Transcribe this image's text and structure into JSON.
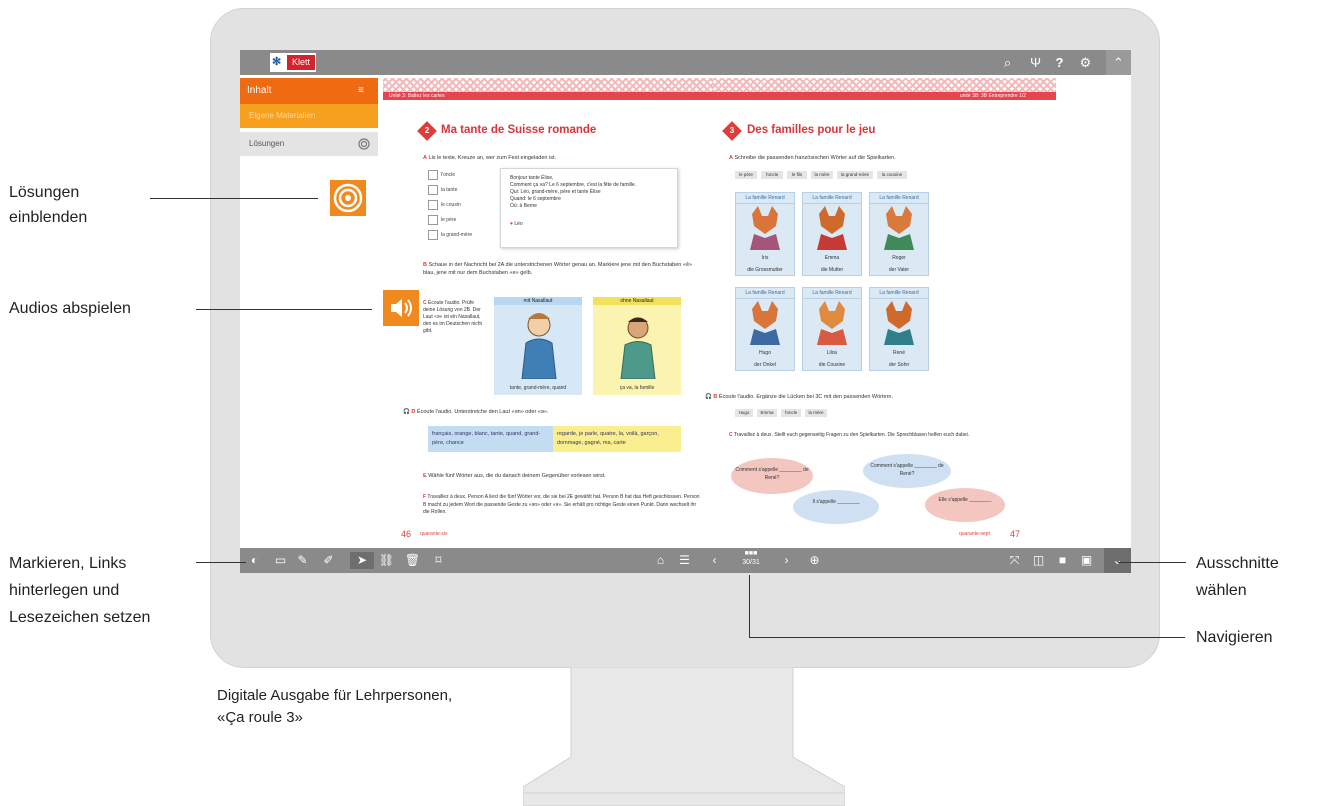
{
  "app": {
    "logo_text": "Klett",
    "topbar_icons": [
      "search-icon",
      "tuning-fork-icon",
      "help-icon",
      "settings-icon",
      "chevron-up-icon"
    ],
    "accent_orange": "#ee6b12",
    "accent_red": "#e03c3c"
  },
  "sidebar": {
    "inhalt": "Inhalt",
    "material": "Eigene Materialien",
    "loesungen": "Lösungen"
  },
  "left_page": {
    "header_left": "Unité 3: Battez les cartes",
    "section_number": "2",
    "section_title": "Ma tante de Suisse romande",
    "task_a": "Lis le texte. Kreuze an, wer zum Fest eingeladen ist.",
    "checkbox_items": [
      "l'oncle",
      "la tante",
      "le cousin",
      "le père",
      "la grand-mère"
    ],
    "postcard_lines": [
      "Bonjour tante Élise,",
      "Comment ça va? Le 6 septembre, c'est la fête de famille.",
      "Qui: Léo, grand-mère, père et tante Élise",
      "Quand: le 6 septembre",
      "Où: à Berne",
      "Léo"
    ],
    "task_b": "Schaue in der Nachricht bei 2A die unterstrichenen Wörter genau an. Markiere jene mit den Buchstaben «ê» blau, jene mit nur dem Buchstaben «e» gelb.",
    "task_c": "Écoute l'audio. Prüfe deine Lösung von 2B. Der Laut «ə» ist ein Nasallaut, den es im Deutschen nicht gibt.",
    "mit_nasallaut": "mit Nasallaut",
    "ohne_nasallaut": "ohne Nasallaut",
    "picture_left_caption": "tante, grand-mère, quand",
    "picture_right_caption": "ça va, la famille",
    "task_d": "Écoute l'audio. Unterstreiche den Laut «ən» oder «ə».",
    "words_blue": "français, orange, blanc, tante, quand, grand-père, chance",
    "words_yellow": "regarde, je parle, quatre, la, voilà, garçon, dommage, gagné, ma, carte",
    "task_e": "Wähle fünf Wörter aus, die du danach deinem Gegenüber vorlesen wirst.",
    "task_f": "Travaillez à deux. Person A liest die fünf Wörter vor, die sie bei 2E gewählt hat. Person B hat das Heft geschlossen. Person B macht zu jedem Wort die passende Geste zu «ən» oder «ə». Sie erhält pro richtige Geste einen Punkt. Dann wechselt ihr die Rollen.",
    "page_number": "46",
    "page_footer": "quarante-six"
  },
  "right_page": {
    "header_right": "unité 3B: 3B Entreprendre 1/2",
    "section_number": "3",
    "section_title": "Des familles pour le jeu",
    "task_a": "Schreibe die passenden französischen Wörter auf die Spielkarten.",
    "word_chips": [
      "le père",
      "l'oncle",
      "le fils",
      "la mère",
      "la grand-mère",
      "la cousine"
    ],
    "card_header": "La famille Renard",
    "cards": [
      {
        "name": "Iris",
        "role": "die Grossmutter"
      },
      {
        "name": "Emma",
        "role": "die Mutter"
      },
      {
        "name": "Roger",
        "role": "der Vater"
      },
      {
        "name": "Hugo",
        "role": "der Onkel"
      },
      {
        "name": "Lilou",
        "role": "die Cousine"
      },
      {
        "name": "René",
        "role": "der Sohn"
      }
    ],
    "task_b": "Écoute l'audio. Ergänze die Lücken bei 3C mit den passenden Wörtern.",
    "name_chips": [
      "Hugo",
      "Emma",
      "l'oncle",
      "la mère"
    ],
    "task_c": "Travaillez à deux. Stellt euch gegenseitig Fragen zu den Spielkarten. Die Sprechblasen helfen euch dabei.",
    "bubbles": [
      "Comment s'appelle ________ de René?",
      "Comment s'appelle ________ de René?",
      "Il s'appelle ________",
      "Elle s'appelle ________"
    ],
    "page_number": "47",
    "page_footer": "quarante-sept"
  },
  "bottombar": {
    "page_indicator": "30/31",
    "tools_left": [
      "toggle-icon",
      "note-icon",
      "pen-icon",
      "marker-icon",
      "pointer-icon",
      "link-icon",
      "trash-icon",
      "bookmark-icon"
    ],
    "nav_center": [
      "home-icon",
      "list-icon",
      "chevron-left-icon",
      "grid-icon",
      "chevron-right-icon",
      "zoom-icon"
    ],
    "view_right": [
      "fit-icon",
      "double-page-icon",
      "single-page-icon",
      "section-icon",
      "chevron-down-icon"
    ]
  },
  "callouts": {
    "loesungen_einblenden": "Lösungen einblenden",
    "audios_abspielen": "Audios abspielen",
    "markieren": "Markieren, Links hinterlegen und Lesezeichen setzen",
    "ausschnitte_waehlen": "Ausschnitte wählen",
    "navigieren": "Navigieren"
  },
  "caption": {
    "line1": "Digitale Ausgabe für Lehrpersonen,",
    "line2": "«Ça roule 3»"
  }
}
